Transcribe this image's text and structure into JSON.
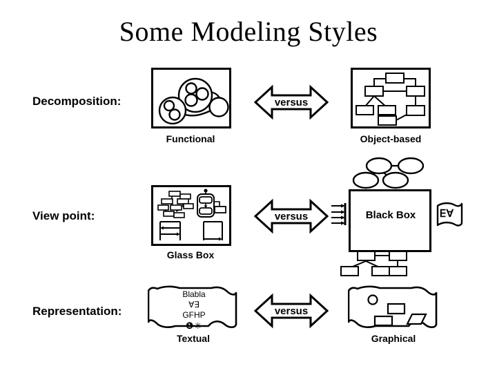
{
  "slide": {
    "title": "Some Modeling Styles",
    "background_color": "#ffffff",
    "ink_color": "#000000"
  },
  "rows": [
    {
      "label": "Decomposition:",
      "left_caption": "Functional",
      "right_caption": "Object-based",
      "comparator": "versus"
    },
    {
      "label": "View point:",
      "left_caption": "Glass Box",
      "right_caption": "Black Box",
      "comparator": "versus"
    },
    {
      "label": "Representation:",
      "left_caption": "Textual",
      "right_caption": "Graphical",
      "comparator": "versus"
    }
  ],
  "labels": {
    "decomposition": "Decomposition:",
    "view_point": "View point:",
    "representation": "Representation:"
  },
  "captions": {
    "functional": "Functional",
    "object_based": "Object-based",
    "glass_box": "Glass Box",
    "black_box": "Black Box",
    "textual": "Textual",
    "graphical": "Graphical"
  },
  "comparators": {
    "versus_1": "versus",
    "versus_2": "versus",
    "versus_3": "versus"
  },
  "black_box": {
    "inner_label": "Black Box",
    "quantifier_glyph": "∀∃"
  },
  "textual_scroll": {
    "line_1": "Blabla",
    "line_2": "∀∃",
    "line_3": "GFHP",
    "line_4": "❶✳"
  },
  "diagram_contents": {
    "functional": "nested bubble data-flow diagram",
    "object_based": "box-and-line object hierarchy",
    "glass_box": "internal class, state and sequence diagrams",
    "black_box": "opaque box with use-case ovals, input arrows, specification scroll and box tree",
    "textual": "scroll with textual specification lines",
    "graphical": "scroll with circle, rectangles and parallelogram shapes"
  }
}
